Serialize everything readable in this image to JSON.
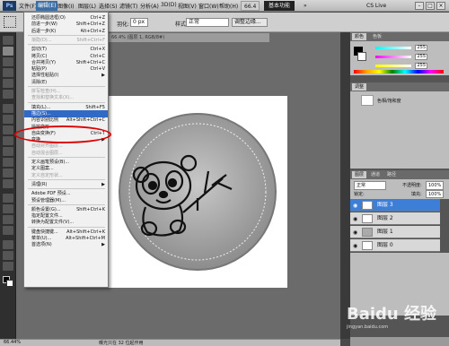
{
  "app": {
    "badge": "Ps",
    "workspace_button": "基本功能",
    "cs_live": "CS Live"
  },
  "menubar": {
    "items": [
      "文件(F)",
      "编辑(E)",
      "图像(I)",
      "图层(L)",
      "选择(S)",
      "滤镜(T)",
      "分析(A)",
      "3D(D)",
      "视图(V)",
      "窗口(W)",
      "帮助(H)"
    ],
    "zoom": "66.4"
  },
  "options": {
    "feather_label": "羽化:",
    "feather": "0 px",
    "style_label": "样式:",
    "style": "正常",
    "refine_button": "调整边缘..."
  },
  "document": {
    "tab": "66.4% (图层 1, RGB/8#)",
    "status_zoom": "66.44%",
    "status_text": "曝光只在 32 位起作用"
  },
  "edit_menu": {
    "items": [
      {
        "label": "还原椭圆选框(O)",
        "shortcut": "Ctrl+Z",
        "disabled": false
      },
      {
        "label": "前进一步(W)",
        "shortcut": "Shift+Ctrl+Z",
        "disabled": false
      },
      {
        "label": "后退一步(K)",
        "shortcut": "Alt+Ctrl+Z",
        "disabled": false
      },
      {
        "sep": true
      },
      {
        "label": "渐隐(D)...",
        "shortcut": "Shift+Ctrl+F",
        "disabled": true
      },
      {
        "sep": true
      },
      {
        "label": "剪切(T)",
        "shortcut": "Ctrl+X",
        "disabled": false
      },
      {
        "label": "拷贝(C)",
        "shortcut": "Ctrl+C",
        "disabled": false
      },
      {
        "label": "合并拷贝(Y)",
        "shortcut": "Shift+Ctrl+C",
        "disabled": false
      },
      {
        "label": "粘贴(P)",
        "shortcut": "Ctrl+V",
        "disabled": false
      },
      {
        "label": "选择性粘贴(I)",
        "shortcut": "",
        "disabled": false,
        "sub": true
      },
      {
        "label": "清除(E)",
        "shortcut": "",
        "disabled": false
      },
      {
        "sep": true
      },
      {
        "label": "拼写检查(H)...",
        "shortcut": "",
        "disabled": true
      },
      {
        "label": "查找和替换文本(X)...",
        "shortcut": "",
        "disabled": true
      },
      {
        "sep": true
      },
      {
        "label": "填充(L)...",
        "shortcut": "Shift+F5",
        "disabled": false
      },
      {
        "label": "描边(S)...",
        "shortcut": "",
        "disabled": false,
        "highlight": true
      },
      {
        "label": "内容识别比例",
        "shortcut": "Alt+Shift+Ctrl+C",
        "disabled": false
      },
      {
        "label": "操控变形",
        "shortcut": "",
        "disabled": false
      },
      {
        "label": "自由变换(F)",
        "shortcut": "Ctrl+T",
        "disabled": false
      },
      {
        "label": "变换",
        "shortcut": "",
        "disabled": false,
        "sub": true
      },
      {
        "label": "自动对齐图层...",
        "shortcut": "",
        "disabled": true
      },
      {
        "label": "自动混合图层...",
        "shortcut": "",
        "disabled": true
      },
      {
        "sep": true
      },
      {
        "label": "定义画笔预设(B)...",
        "shortcut": "",
        "disabled": false
      },
      {
        "label": "定义图案...",
        "shortcut": "",
        "disabled": false
      },
      {
        "label": "定义自定形状...",
        "shortcut": "",
        "disabled": true
      },
      {
        "sep": true
      },
      {
        "label": "清理(R)",
        "shortcut": "",
        "disabled": false,
        "sub": true
      },
      {
        "sep": true
      },
      {
        "label": "Adobe PDF 预设...",
        "shortcut": "",
        "disabled": false
      },
      {
        "label": "预设管理器(M)...",
        "shortcut": "",
        "disabled": false
      },
      {
        "sep": true
      },
      {
        "label": "颜色设置(G)...",
        "shortcut": "Shift+Ctrl+K",
        "disabled": false
      },
      {
        "label": "指定配置文件...",
        "shortcut": "",
        "disabled": false
      },
      {
        "label": "转换为配置文件(V)...",
        "shortcut": "",
        "disabled": false
      },
      {
        "sep": true
      },
      {
        "label": "键盘快捷键...",
        "shortcut": "Alt+Shift+Ctrl+K",
        "disabled": false
      },
      {
        "label": "菜单(U)...",
        "shortcut": "Alt+Shift+Ctrl+M",
        "disabled": false
      },
      {
        "label": "首选项(N)",
        "shortcut": "",
        "disabled": false,
        "sub": true
      }
    ]
  },
  "color_panel": {
    "r": "255",
    "g": "255",
    "b": "255",
    "tabs": [
      "颜色",
      "色板"
    ]
  },
  "adjust_panel": {
    "tab": "调整",
    "item": "色相/饱和度"
  },
  "layers_panel": {
    "tabs": [
      "图层",
      "通道",
      "路径"
    ],
    "mode": "正常",
    "opacity_label": "不透明度:",
    "opacity": "100%",
    "lock_label": "锁定:",
    "fill_label": "填充:",
    "fill": "100%",
    "layers": [
      "图层 3",
      "图层 2",
      "图层 1",
      "图层 0"
    ]
  },
  "watermark": {
    "text": "Baidu 经验",
    "url": "jingyan.baidu.com"
  }
}
